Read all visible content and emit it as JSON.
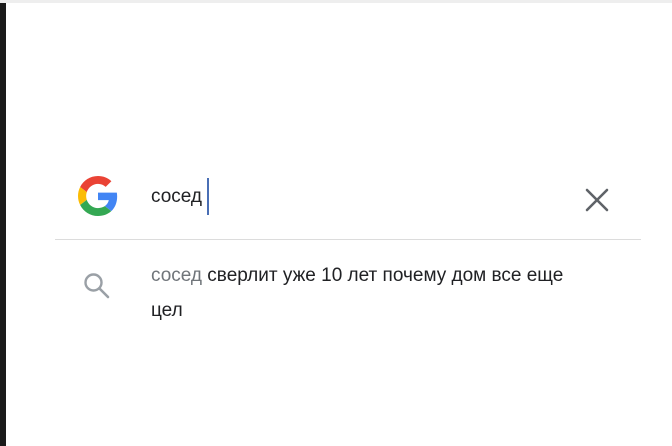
{
  "search": {
    "query": "сосед",
    "logo_colors": {
      "blue": "#4285F4",
      "red": "#EA4335",
      "yellow": "#FBBC05",
      "green": "#34A853"
    },
    "logo_icon": "google-g-icon",
    "clear_icon": "close-icon"
  },
  "suggestions": [
    {
      "icon": "search-icon",
      "typed": "сосед",
      "completion": " сверлит уже 10 лет почему дом все еще цел"
    }
  ]
}
